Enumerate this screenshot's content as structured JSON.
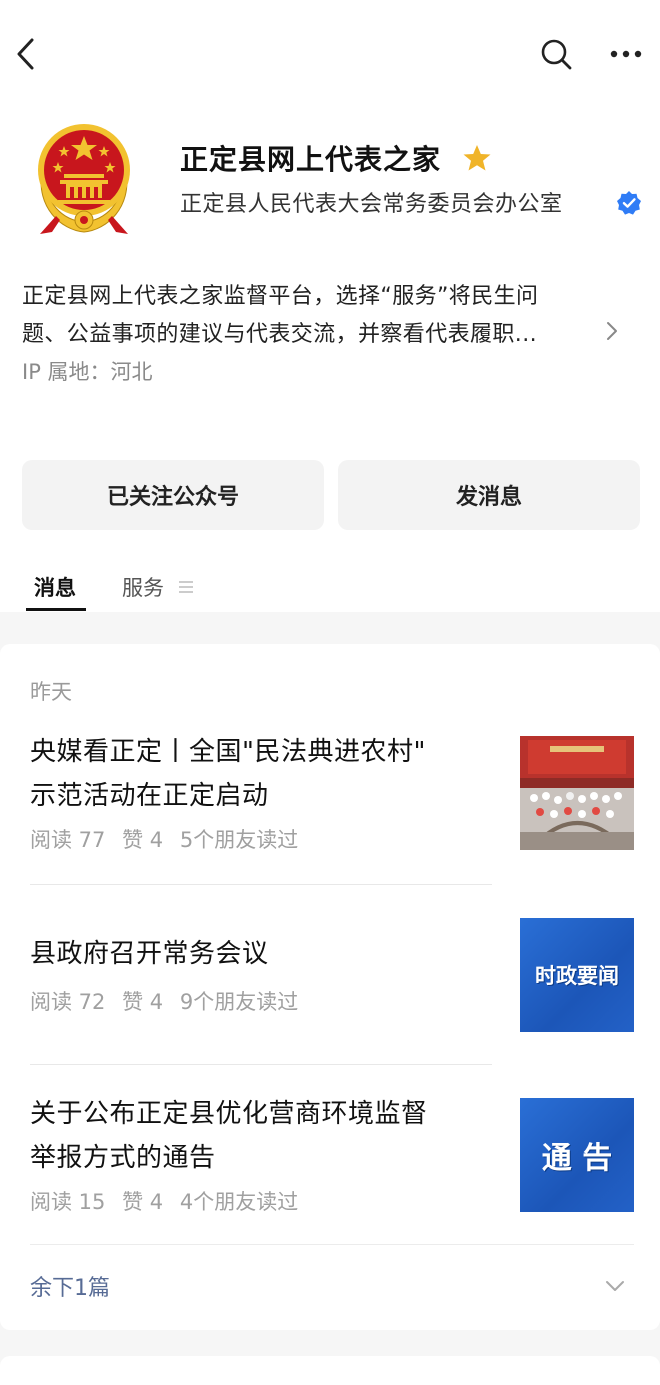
{
  "account": {
    "name": "正定县网上代表之家",
    "owner": "正定县人民代表大会常务委员会办公室",
    "description_line1": "正定县网上代表之家监督平台，选择“服务”将民生问",
    "description_line2": "题、公益事项的建议与代表交流，并察看代表履职...",
    "ip_location": "IP 属地：河北"
  },
  "buttons": {
    "follow": "已关注公众号",
    "message": "发消息"
  },
  "tabs": {
    "messages": "消息",
    "services": "服务"
  },
  "feed": {
    "date": "昨天",
    "articles": [
      {
        "title_line1": "央媒看正定丨全国\"民法典进农村\"",
        "title_line2": "示范活动在正定启动",
        "reads": "阅读 77",
        "likes": "赞 4",
        "friends": "5个朋友读过",
        "thumb_text": ""
      },
      {
        "title_line1": "县政府召开常务会议",
        "title_line2": "",
        "reads": "阅读 72",
        "likes": "赞 4",
        "friends": "9个朋友读过",
        "thumb_text": "时政要闻"
      },
      {
        "title_line1": "关于公布正定县优化营商环境监督",
        "title_line2": "举报方式的通告",
        "reads": "阅读 15",
        "likes": "赞 4",
        "friends": "4个朋友读过",
        "thumb_text": "通 告"
      }
    ],
    "more": "余下1篇"
  },
  "colors": {
    "link": "#576b95",
    "verified": "#2f7cf6",
    "star": "#f0b429",
    "emblem_red": "#c8161d",
    "emblem_gold": "#f2c230"
  },
  "icons": {
    "back": "chevron-left-icon",
    "search": "search-icon",
    "more": "more-dots-icon",
    "star": "star-icon",
    "verified": "verified-badge-icon",
    "expand": "chevron-down-icon"
  }
}
